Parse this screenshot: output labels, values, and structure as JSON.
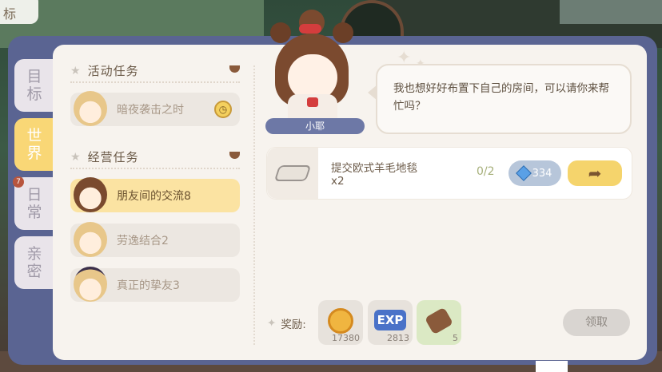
{
  "corner_tag": "标",
  "side_tabs": [
    {
      "label": "目标"
    },
    {
      "label": "世界"
    },
    {
      "label": "日常",
      "badge": "7"
    },
    {
      "label": "亲密"
    }
  ],
  "sections": {
    "activity": {
      "title": "活动任务",
      "tasks": [
        {
          "label": "暗夜袭击之时"
        }
      ]
    },
    "business": {
      "title": "经营任务",
      "tasks": [
        {
          "label": "朋友间的交流8"
        },
        {
          "label": "劳逸结合2"
        },
        {
          "label": "真正的挚友3"
        }
      ]
    }
  },
  "npc": {
    "name": "小耶",
    "dialog": "我也想好好布置下自己的房间，可以请你来帮忙吗？"
  },
  "requirement": {
    "item_name": "提交欧式羊毛地毯",
    "item_qty": "x2",
    "progress": "0/2",
    "gem_cost": "334"
  },
  "rewards": {
    "label": "奖励:",
    "items": [
      {
        "icon": "coin-icon",
        "amount": "17380"
      },
      {
        "icon": "exp-icon",
        "text": "EXP",
        "amount": "2813"
      },
      {
        "icon": "log-icon",
        "amount": "5"
      }
    ]
  },
  "claim_label": "领取",
  "colors": {
    "frame": "#5a6492",
    "panel": "#f7f3ee",
    "active_tab": "#f9d776",
    "active_task": "#fbe3a2",
    "go_button": "#f5d46c"
  }
}
